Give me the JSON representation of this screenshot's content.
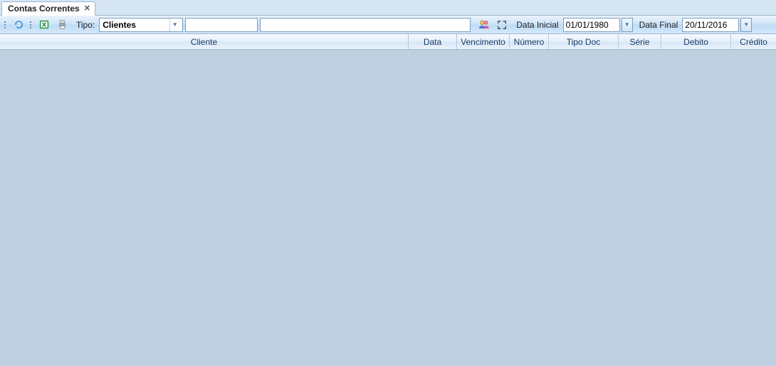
{
  "tab": {
    "title": "Contas Correntes"
  },
  "toolbar": {
    "tipo_label": "Tipo:",
    "tipo_value": "Clientes",
    "code_value": "",
    "name_value": "",
    "data_inicial_label": "Data Inicial",
    "data_inicial_value": "01/01/1980",
    "data_final_label": "Data Final",
    "data_final_value": "20/11/2016"
  },
  "columns": {
    "cliente": "Cliente",
    "data": "Data",
    "vencimento": "Vencimento",
    "numero": "Número",
    "tipo_doc": "Tipo Doc",
    "serie": "Série",
    "debito": "Debito",
    "credito": "Crédito"
  }
}
